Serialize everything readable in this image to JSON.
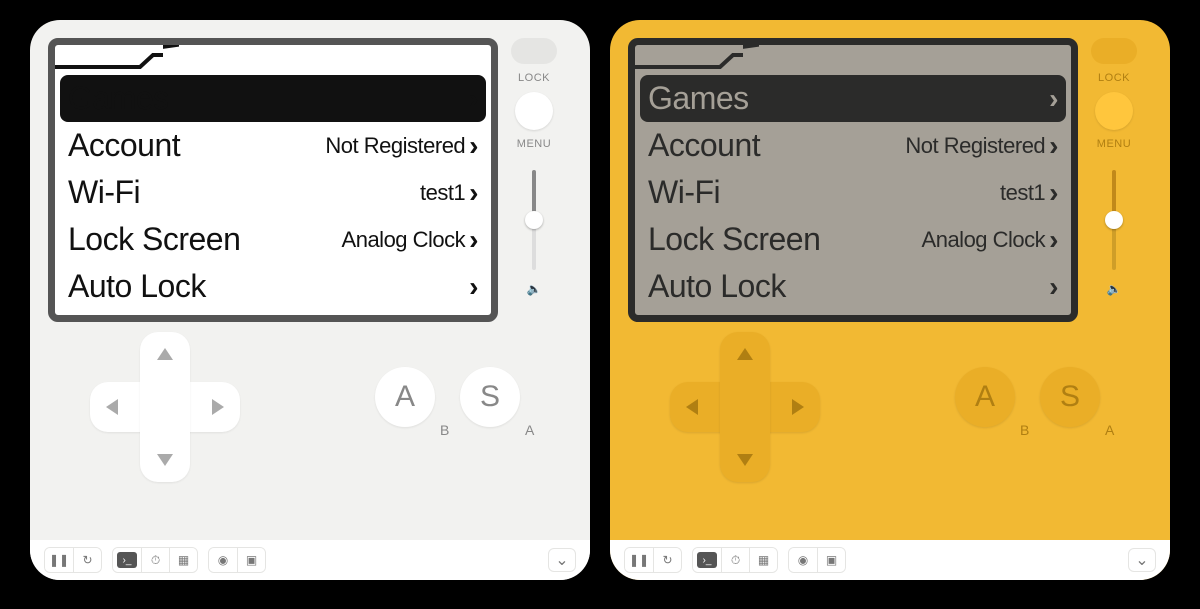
{
  "devices": [
    {
      "theme": "light"
    },
    {
      "theme": "yellow"
    }
  ],
  "side": {
    "lock_label": "LOCK",
    "menu_label": "MENU"
  },
  "buttons": {
    "a_key": "S",
    "a_sub": "A",
    "b_key": "A",
    "b_sub": "B"
  },
  "menu": {
    "selected_index": 0,
    "items": [
      {
        "label": "Games",
        "value": ""
      },
      {
        "label": "Account",
        "value": "Not Registered"
      },
      {
        "label": "Wi-Fi",
        "value": "test1"
      },
      {
        "label": "Lock Screen",
        "value": "Analog Clock"
      },
      {
        "label": "Auto Lock",
        "value": ""
      }
    ]
  },
  "toolbar": {
    "pause": "❚❚",
    "restart": "↻",
    "console": "›_",
    "stopwatch": "⏱",
    "chip": "▦",
    "camera": "◉",
    "record": "▣",
    "expand": "⌄"
  }
}
